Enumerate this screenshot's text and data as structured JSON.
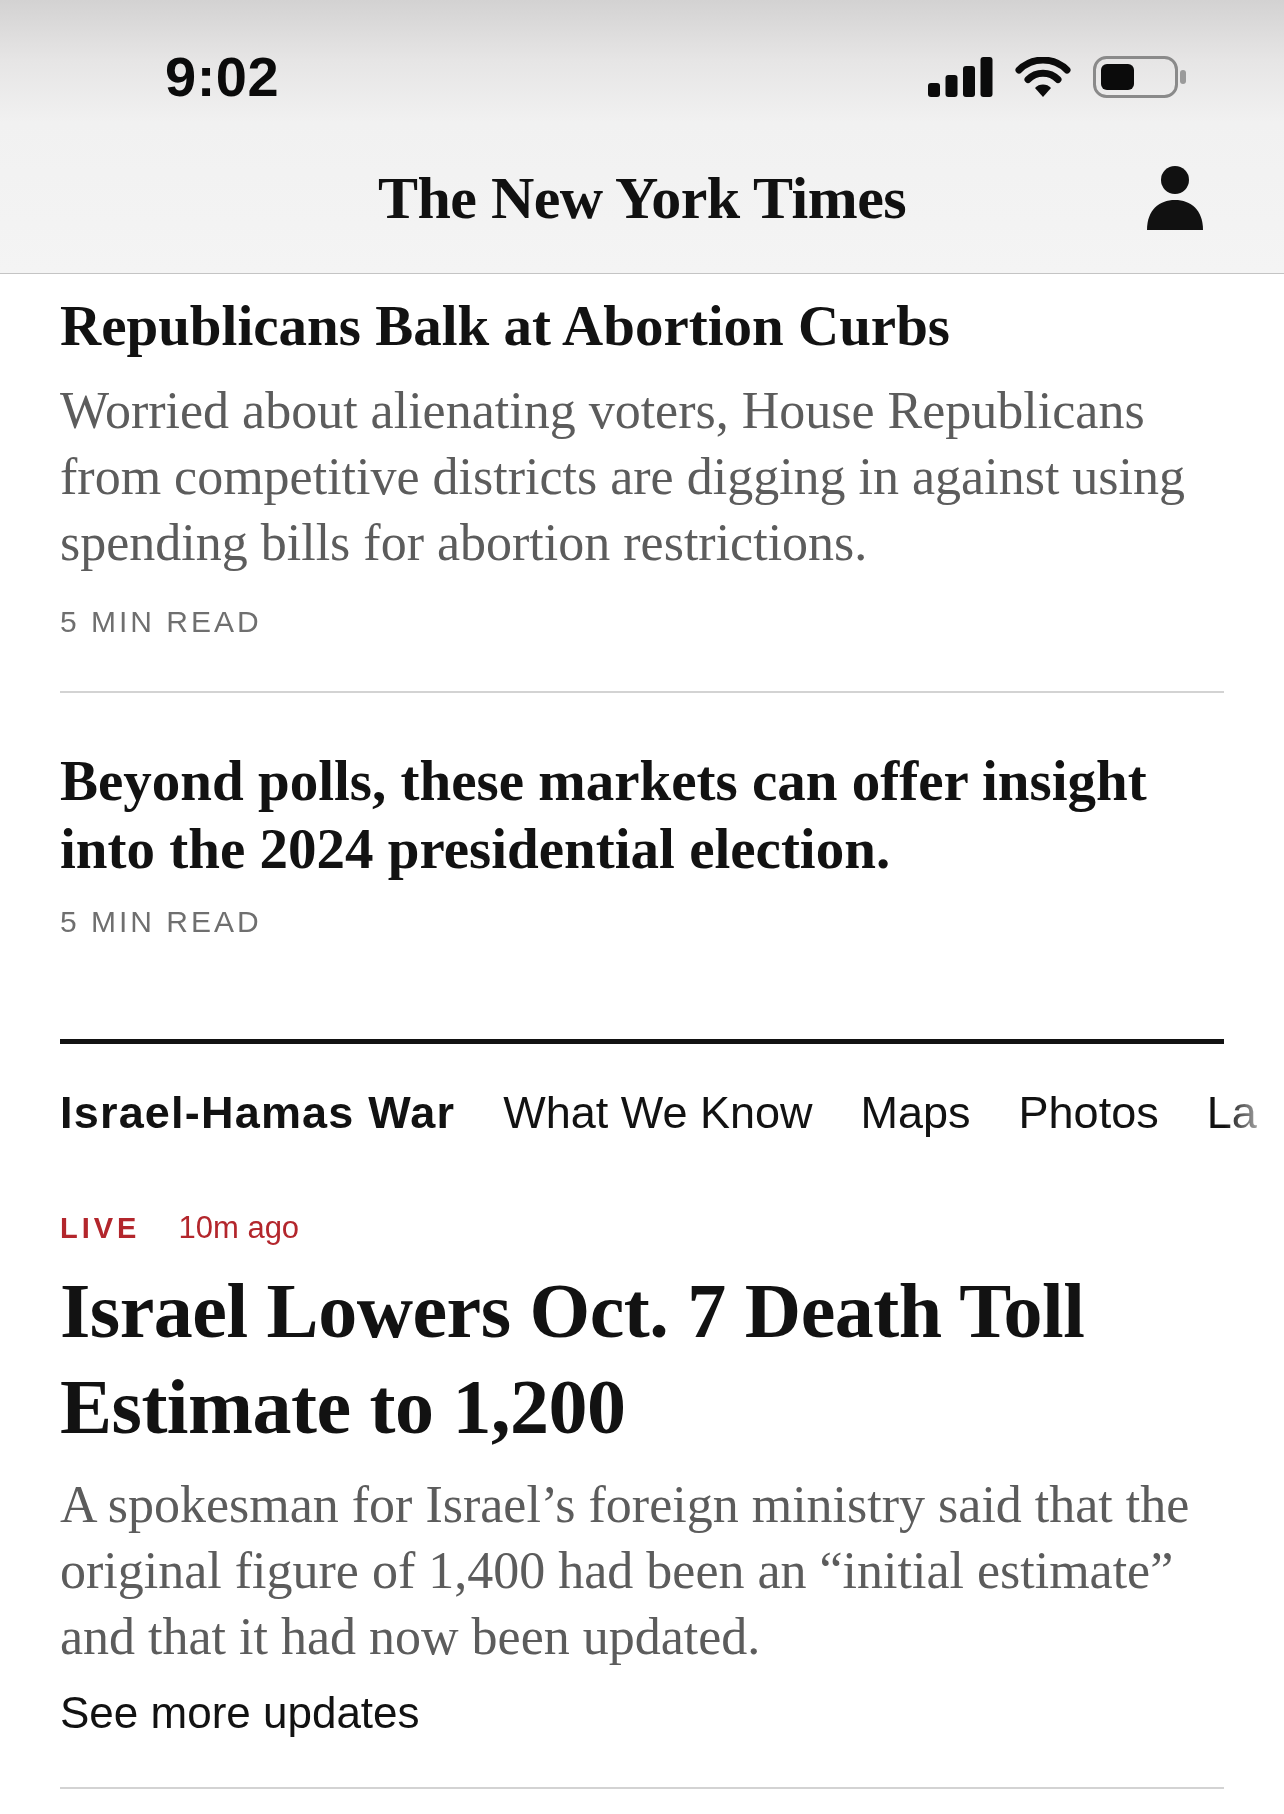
{
  "status_bar": {
    "time": "9:02"
  },
  "header": {
    "logo": "The New York Times"
  },
  "stories": [
    {
      "headline": "Republicans Balk at Abortion Curbs",
      "summary": "Worried about alienating voters, House Republicans from competitive districts are digging in against using spending bills for abortion restrictions.",
      "read_time": "5 MIN READ"
    },
    {
      "headline": "Beyond polls, these markets can offer insight into the 2024 presidential election.",
      "read_time": "5 MIN READ"
    }
  ],
  "section_nav": {
    "title": "Israel-Hamas War",
    "links": [
      "What We Know",
      "Maps",
      "Photos",
      "La"
    ]
  },
  "live_story": {
    "badge": "LIVE",
    "timestamp": "10m ago",
    "headline": "Israel Lowers Oct. 7 Death Toll Estimate to 1,200",
    "summary": "A spokesman for Israel’s foreign ministry said that the original figure of 1,400 had been an “initial estimate” and that it had now been updated.",
    "link": "See more updates"
  }
}
